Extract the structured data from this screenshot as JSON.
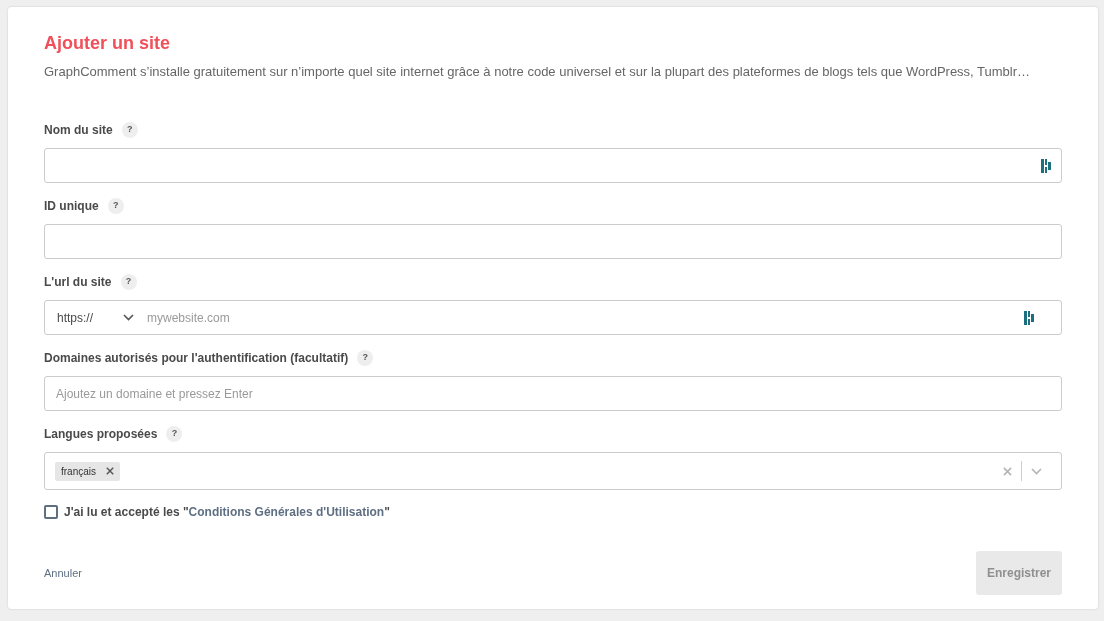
{
  "title": "Ajouter un site",
  "description": "GraphComment s’installe gratuitement sur n’importe quel site internet grâce à notre code universel et sur la plupart des plateformes de blogs tels que WordPress, Tumblr…",
  "fields": [
    {
      "kind": "text",
      "label": "Nom du site",
      "help": "?",
      "autofill_icon": true
    },
    {
      "kind": "text",
      "label": "ID unique",
      "help": "?",
      "autofill_icon": false
    },
    {
      "kind": "url",
      "label": "L'url du site",
      "help": "?",
      "protocol": "https://",
      "placeholder": "mywebsite.com",
      "autofill_icon": true
    },
    {
      "kind": "text",
      "label": "Domaines autorisés pour l'authentification (facultatif)",
      "help": "?",
      "placeholder": "Ajoutez un domaine et pressez Enter",
      "autofill_icon": false
    },
    {
      "kind": "multiselect",
      "label": "Langues proposées",
      "help": "?",
      "tags": [
        {
          "label": "français"
        }
      ]
    }
  ],
  "terms": {
    "checked": false,
    "text_before": "J'ai lu et accepté les \"",
    "link": "Conditions Générales d'Utilisation",
    "text_after": "\""
  },
  "cancel": "Annuler",
  "submit": {
    "label": "Enregistrer",
    "disabled": true
  }
}
